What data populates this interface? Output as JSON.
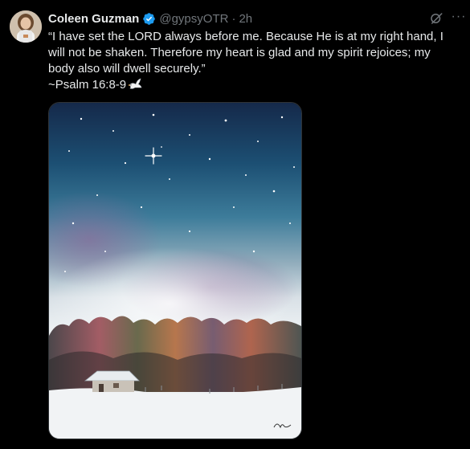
{
  "post": {
    "author_name": "Coleen Guzman",
    "handle": "@gypsyOTR",
    "separator": "·",
    "time": "2h",
    "more_label": "···",
    "text_line1": "“I have set the LORD always before me. Because He is at my right hand, I will not be shaken. Therefore my heart is glad and my spirit rejoices; my body also will dwell securely.”",
    "text_line2": "~Psalm 16:8-9",
    "icons": {
      "verified": "verified-badge-icon",
      "grok": "grok-icon",
      "more": "more-icon",
      "dove": "dove-emoji"
    },
    "colors": {
      "background": "#000000",
      "text": "#e7e9ea",
      "muted": "#71767b",
      "verified": "#1d9bf0"
    }
  }
}
